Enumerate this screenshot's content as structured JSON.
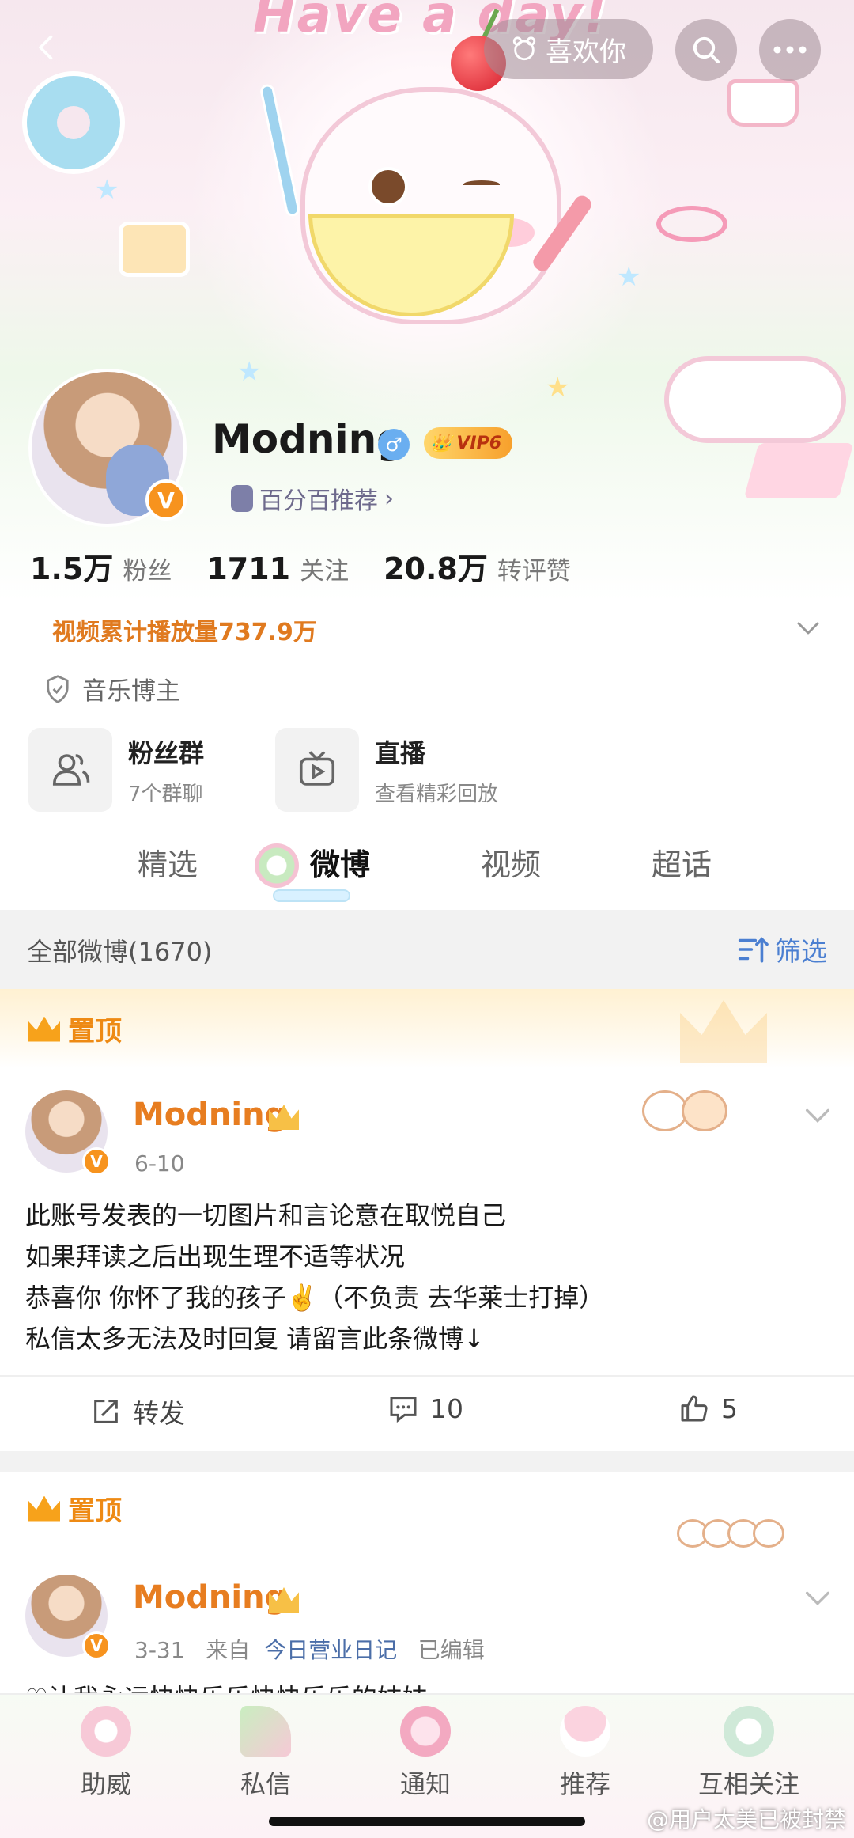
{
  "cover": {
    "title": "Have a   day!"
  },
  "topbar": {
    "like_label": "喜欢你"
  },
  "profile": {
    "name": "Modning",
    "vip_label": "VIP6",
    "avatar_badge": "V",
    "recommend_label": "百分百推荐",
    "recommend_arrow": "›",
    "stats": [
      {
        "value": "1.5万",
        "label": "粉丝"
      },
      {
        "value": "1711",
        "label": "关注"
      },
      {
        "value": "20.8万",
        "label": "转评赞"
      }
    ],
    "video_plays": "视频累计播放量737.9万",
    "tag": "音乐博主"
  },
  "quick_cards": [
    {
      "title": "粉丝群",
      "sub": "7个群聊"
    },
    {
      "title": "直播",
      "sub": "查看精彩回放"
    }
  ],
  "tabs": [
    {
      "label": "精选"
    },
    {
      "label": "微博",
      "active": true
    },
    {
      "label": "视频"
    },
    {
      "label": "超话"
    }
  ],
  "filter_bar": {
    "all_label": "全部微博(1670)",
    "filter_label": "筛选"
  },
  "pinned_label": "置顶",
  "posts": [
    {
      "name": "Modning",
      "date": "6-10",
      "lines": [
        "此账号发表的一切图片和言论意在取悦自己",
        "如果拜读之后出现生理不适等状况",
        "恭喜你 你怀了我的孩子✌️（不负责 去华莱士打掉）",
        "私信太多无法及时回复 请留言此条微博↓"
      ],
      "actions": {
        "repost": "转发",
        "comments": "10",
        "likes": "5"
      }
    },
    {
      "name": "Modning",
      "date": "3-31",
      "from_label": "来自",
      "source": "今日营业日记",
      "edited": "已编辑",
      "preview": "♡让我永远快快乐乐快快乐乐的妹妹"
    }
  ],
  "bottom_nav": [
    {
      "label": "助威"
    },
    {
      "label": "私信"
    },
    {
      "label": "通知"
    },
    {
      "label": "推荐"
    },
    {
      "label": "互相关注"
    }
  ],
  "watermark": "@用户太美已被封禁",
  "colors": {
    "accent_orange": "#e77d20",
    "link_blue": "#4b7fd1",
    "vip_gold": "#f7a02c"
  }
}
